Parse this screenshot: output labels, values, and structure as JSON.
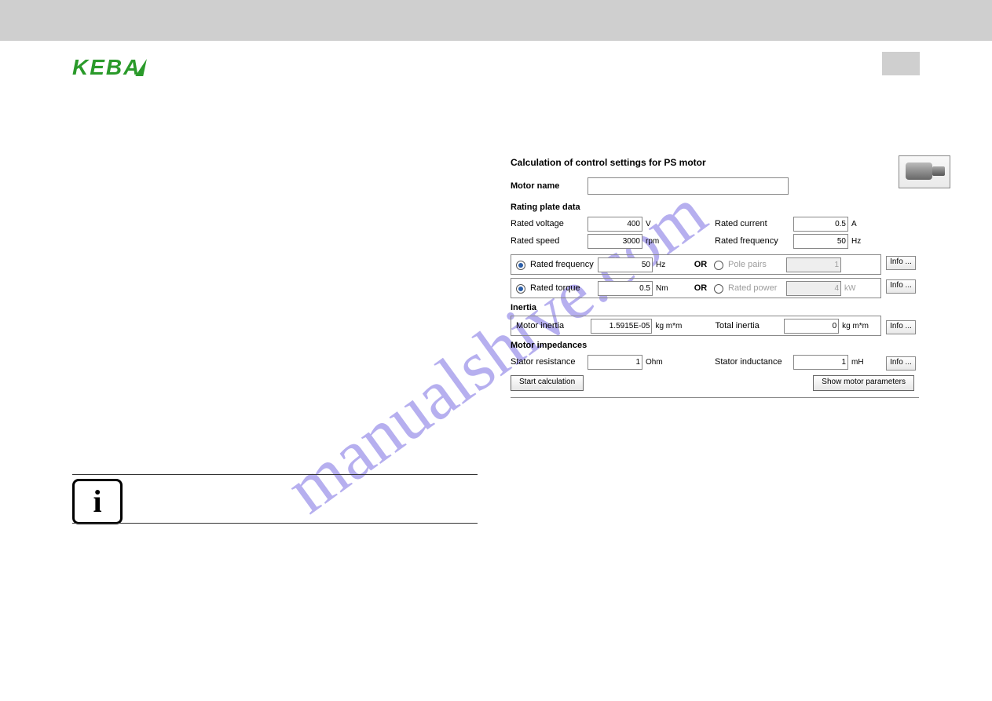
{
  "logo": {
    "text": "KEBA"
  },
  "watermark": "manualshive.com",
  "info_icon_glyph": "i",
  "dialog": {
    "title": "Calculation of control settings for PS motor",
    "motor_name_label": "Motor name",
    "motor_name_value": "",
    "rating_plate_header": "Rating plate data",
    "rated_voltage": {
      "label": "Rated voltage",
      "value": "400",
      "unit": "V"
    },
    "rated_current": {
      "label": "Rated current",
      "value": "0.5",
      "unit": "A"
    },
    "rated_speed": {
      "label": "Rated speed",
      "value": "3000",
      "unit": "rpm"
    },
    "rated_frequency_top": {
      "label": "Rated frequency",
      "value": "50",
      "unit": "Hz"
    },
    "choice1": {
      "left": {
        "label": "Rated frequency",
        "value": "50",
        "unit": "Hz",
        "selected": true
      },
      "or": "OR",
      "right": {
        "label": "Pole pairs",
        "value": "1",
        "unit": "",
        "selected": false
      }
    },
    "choice2": {
      "left": {
        "label": "Rated torque",
        "value": "0.5",
        "unit": "Nm",
        "selected": true
      },
      "or": "OR",
      "right": {
        "label": "Rated power",
        "value": "4",
        "unit": "kW",
        "selected": false
      }
    },
    "inertia_header": "Inertia",
    "motor_inertia": {
      "label": "Motor inertia",
      "value": "1.5915E-05",
      "unit": "kg m*m"
    },
    "total_inertia": {
      "label": "Total inertia",
      "value": "0",
      "unit": "kg m*m"
    },
    "impedances_header": "Motor impedances",
    "stator_resistance": {
      "label": "Stator resistance",
      "value": "1",
      "unit": "Ohm"
    },
    "stator_inductance": {
      "label": "Stator inductance",
      "value": "1",
      "unit": "mH"
    },
    "info_btn_label": "Info ...",
    "start_calc_label": "Start calculation",
    "show_params_label": "Show motor parameters"
  }
}
